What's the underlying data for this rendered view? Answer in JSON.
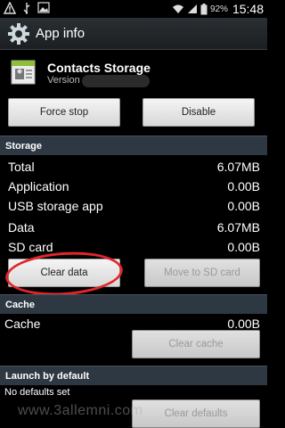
{
  "status_bar": {
    "battery_percent": "92%",
    "time": "15:48",
    "icons": [
      "warning-icon",
      "usb-icon",
      "image-icon",
      "wifi-icon",
      "signal-icon",
      "battery-icon"
    ]
  },
  "title_bar": {
    "title": "App info",
    "icon": "settings-gear-icon"
  },
  "app": {
    "name": "Contacts Storage",
    "version_label": "Version"
  },
  "actions": {
    "force_stop": "Force stop",
    "disable": "Disable"
  },
  "storage": {
    "header": "Storage",
    "rows": [
      {
        "label": "Total",
        "value": "6.07MB"
      },
      {
        "label": "Application",
        "value": "0.00B"
      },
      {
        "label": "USB storage app",
        "value": "0.00B"
      },
      {
        "label": "Data",
        "value": "6.07MB"
      },
      {
        "label": "SD card",
        "value": "0.00B"
      }
    ],
    "clear_data": "Clear data",
    "move_to_sd": "Move to SD card"
  },
  "cache": {
    "header": "Cache",
    "label": "Cache",
    "value": "0.00B",
    "clear_cache": "Clear cache"
  },
  "launch": {
    "header": "Launch by default",
    "no_defaults": "No defaults set",
    "clear_defaults": "Clear defaults"
  },
  "watermark": "www.3allemni.com",
  "colors": {
    "section_header": "#2e3842",
    "highlight_ellipse": "#e0262b"
  }
}
